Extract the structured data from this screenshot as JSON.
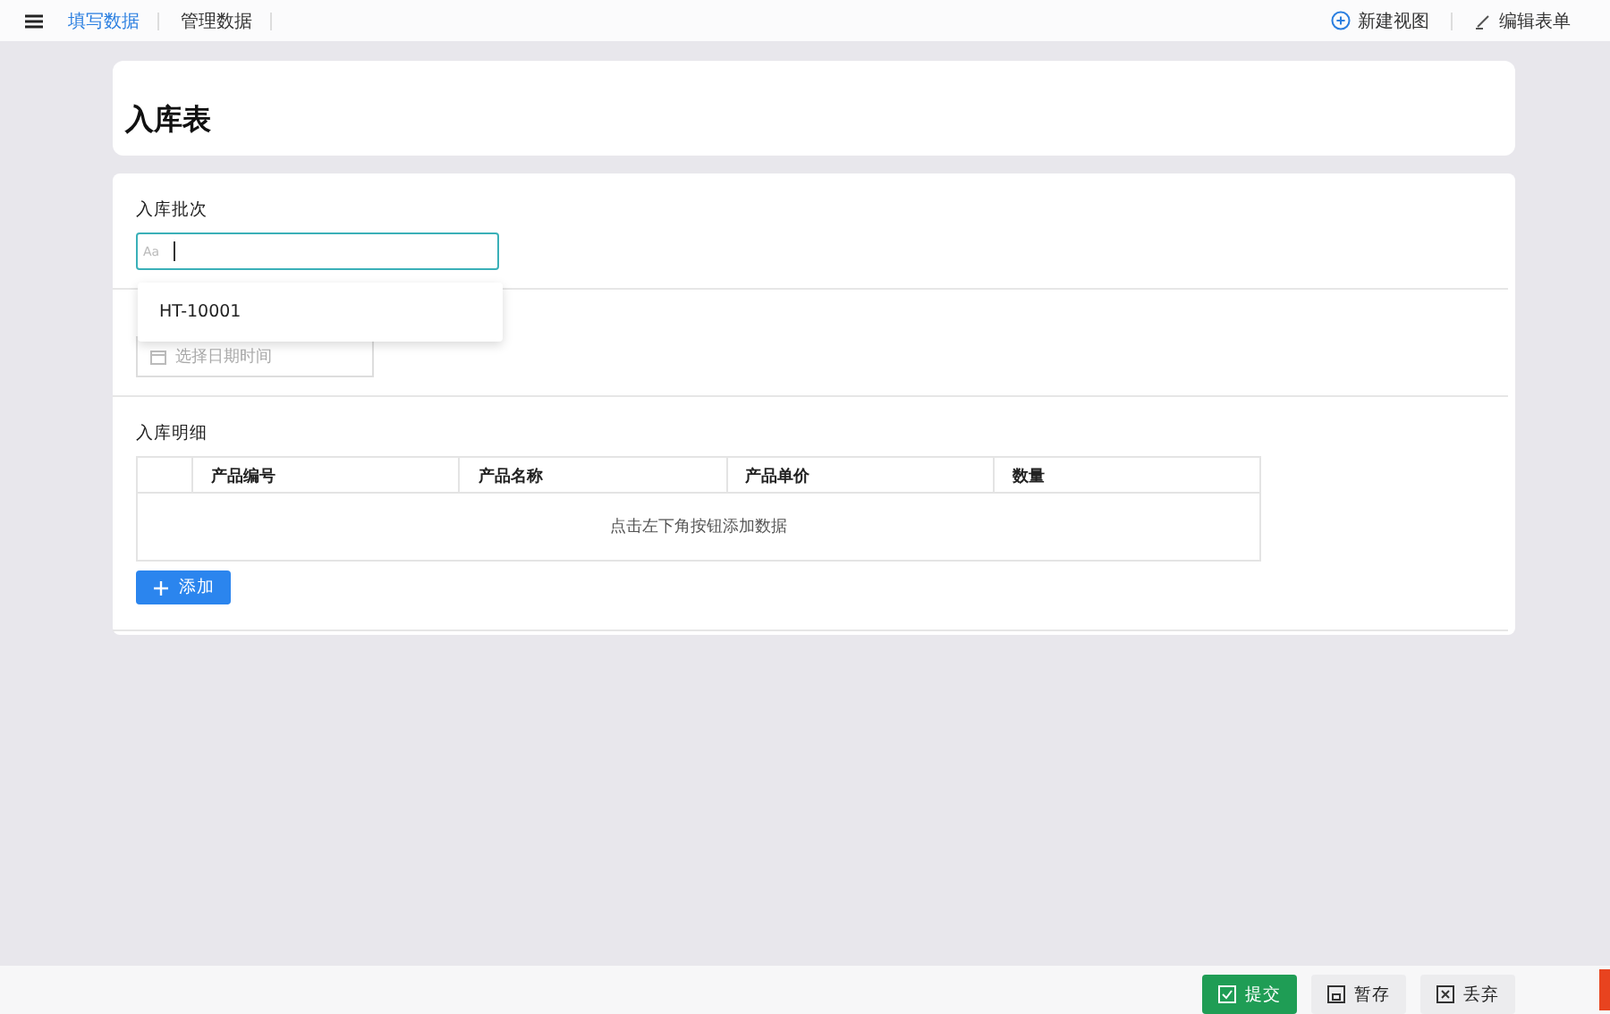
{
  "tabs": [
    {
      "label": "填写数据",
      "selected": true
    },
    {
      "label": "管理数据",
      "selected": false
    }
  ],
  "actions": [
    {
      "label": "新建视图",
      "kind": "add"
    },
    {
      "label": "编辑表单",
      "kind": "edit"
    }
  ],
  "form_title": "入库表",
  "batch_field": {
    "label": "入库批次",
    "placeholder": "Aa",
    "focused": true
  },
  "dropdown": {
    "options": [
      "HT-10001"
    ]
  },
  "date_field": {
    "placeholder": "选择日期时间"
  },
  "details": {
    "label": "入库明细",
    "columns": [
      "产品编号",
      "产品名称",
      "产品单价",
      "数量"
    ],
    "empty_text": "点击左下角按钮添加数据",
    "add_button": "添加"
  },
  "footer_buttons": [
    {
      "label": "提交",
      "kind": "submit"
    },
    {
      "label": "暂存",
      "kind": "save"
    },
    {
      "label": "丢弃",
      "kind": "discard"
    }
  ]
}
